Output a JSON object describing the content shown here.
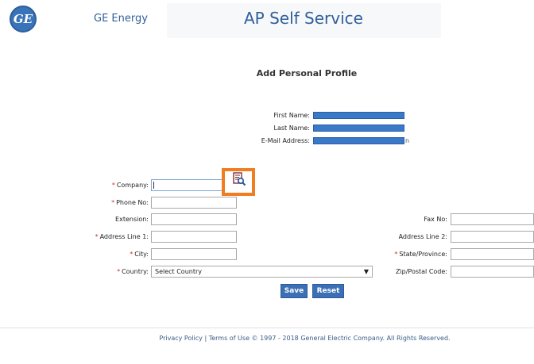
{
  "header": {
    "logo_text": "GE",
    "brand": "GE Energy",
    "title": "AP Self Service"
  },
  "page": {
    "title": "Add Personal Profile"
  },
  "profile": {
    "first_name_label": "First Name:",
    "last_name_label": "Last Name:",
    "email_label": "E-Mail Address:",
    "email_tail": "n"
  },
  "form": {
    "required_marker": "*",
    "company_label": "Company:",
    "phone_label": "Phone No:",
    "extension_label": "Extension:",
    "address1_label": "Address Line 1:",
    "city_label": "City:",
    "country_label": "Country:",
    "country_selected": "Select Country",
    "fax_label": "Fax No:",
    "address2_label": "Address Line 2:",
    "state_label": "State/Province:",
    "zip_label": "Zip/Postal Code:",
    "company_value": "",
    "phone_value": "",
    "extension_value": "",
    "address1_value": "",
    "city_value": "",
    "fax_value": "",
    "address2_value": "",
    "state_value": "",
    "zip_value": ""
  },
  "icons": {
    "lookup": "lookup-search-icon",
    "dropdown": "chevron-down-icon"
  },
  "actions": {
    "save": "Save",
    "reset": "Reset"
  },
  "footer": {
    "text": "Privacy Policy | Terms of Use  © 1997 - 2018 General Electric Company. All Rights Reserved."
  },
  "colors": {
    "accent": "#2f5f9a",
    "button": "#3b6fb6",
    "highlight": "#f07d22",
    "required": "#d32f2f",
    "redaction": "#3a78c8"
  }
}
